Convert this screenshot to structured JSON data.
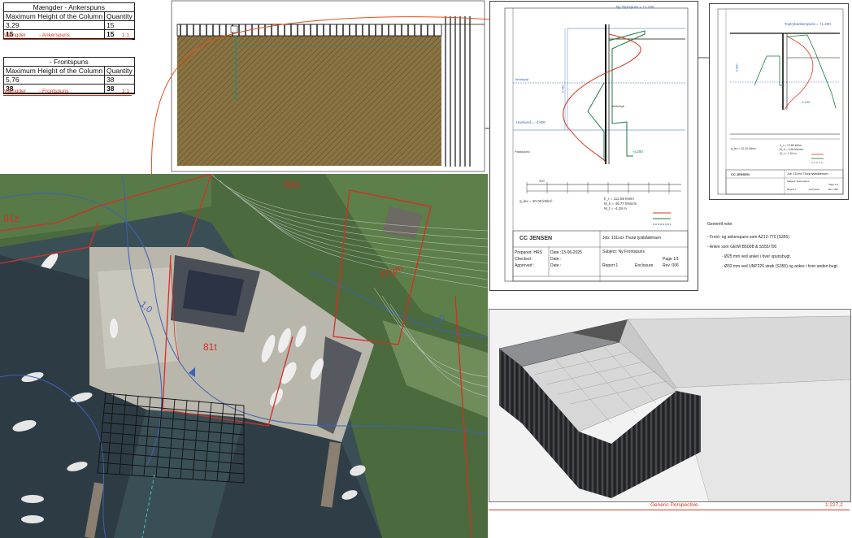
{
  "anker_table": {
    "title": "Mængder - Ankerspuns",
    "col1": "Maximum Height of the Column",
    "col2": "Quantity",
    "row1": [
      "3,29",
      "15"
    ],
    "total": [
      "15",
      "15"
    ],
    "footer_left": "Mængder",
    "footer_mid": "- Ankerspuns",
    "footer_right": "1:1"
  },
  "front_table": {
    "title": "- Frontspuns",
    "col1": "Maximum Height of the Column",
    "col2": "Quantity",
    "row1": [
      "5,76",
      "38"
    ],
    "total": [
      "38",
      "38"
    ],
    "footer_left": "Mængder",
    "footer_mid": "- Frontspuns",
    "footer_right": "1:1"
  },
  "map": {
    "zones": [
      "81z",
      "81c",
      "81t",
      "47gm"
    ],
    "contours": [
      "1,0",
      "4,0"
    ]
  },
  "section_sheet": {
    "top_level": "Ny Toprspuns = +1.200",
    "water": "Vandspejl",
    "ground": "Havbund = -3.800",
    "bottom": "-4.200",
    "dim": "3.700",
    "scale": "100",
    "note1": "Passivjord",
    "note2": "Aktivtryk",
    "stats": [
      "h_r = 112.65 kN/m",
      "M_k = 46.77 kNm/m",
      "M_t = -4.28 m"
    ],
    "q": "q_lev = 20.00 kN/m²",
    "company": "CC JENSEN",
    "job": "Job: 131xxx Thurø lystbådehavn",
    "subject": "Subject: Ny Frontspuns",
    "prepared": "Prepared :HRS",
    "checked": "Checked :",
    "approved": "Approved :",
    "date": "Date :13-06-2025",
    "date2": "Date :",
    "date3": "Date :",
    "report": "Report 1",
    "enclosure": "Enclosure",
    "page": "Page 1/1",
    "rev": "Rev. 006"
  },
  "anchor_sheet": {
    "top_level": "Toptrykankerspuns = +1.200",
    "dim": "3.000",
    "bottom": "-2.100",
    "stats": [
      "h_r = 12.85 kN/m",
      "M_k = 4.56 kNm/m",
      "M_t = 1.34 m"
    ],
    "q": "q_lev = 20.00 kN/m²",
    "job": "Job: 131xxx Thurø lystbådehavn",
    "subject": "Subject: Ankerspuns",
    "page": "Page 1/1",
    "rev": "Rev. 006",
    "report": "Report 1",
    "enclosure": "Enclosure"
  },
  "notes": {
    "heading": "Generelt note:",
    "lines": [
      "- Front- og ankerspuns som AZ12-770 (S355)",
      "- Ankre som GEWI B500B & S555/700",
      "- Ø25 mm ved anker i hver spunsbugt.",
      "- Ø32 mm ved UNP220 strøk (S355) og ankre i hver anden bugt."
    ]
  },
  "perspective": {
    "label": "Generic Perspective",
    "scale": "1:227,2"
  },
  "colors": {
    "accent_red": "#d23a1c",
    "soil": "#8a7342",
    "blue": "#3b62b8",
    "green": "#1c7a3c"
  }
}
